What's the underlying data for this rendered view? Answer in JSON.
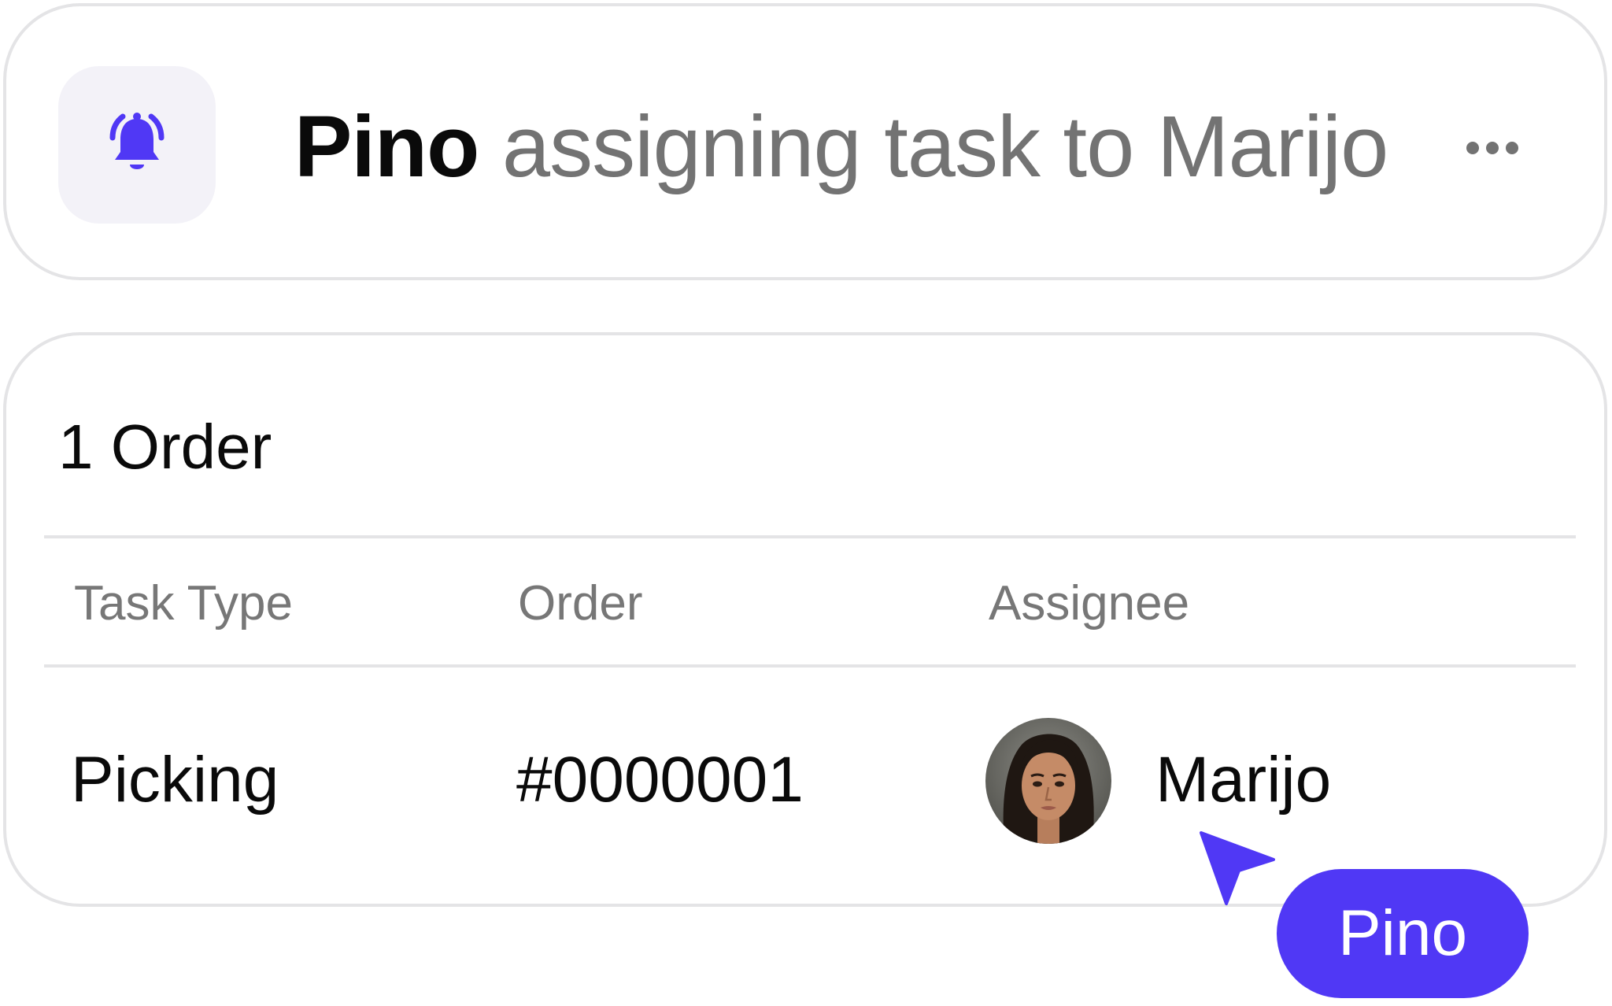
{
  "notification": {
    "actor": "Pino",
    "message": "assigning task to Marijo",
    "icon": "bell-ringing-icon",
    "more_icon": "ellipsis-icon"
  },
  "order_card": {
    "title": "1 Order",
    "columns": [
      "Task Type",
      "Order",
      "Assignee"
    ],
    "rows": [
      {
        "task_type": "Picking",
        "order": "#0000001",
        "assignee": "Marijo"
      }
    ]
  },
  "cursor": {
    "label": "Pino",
    "icon": "cursor-arrow-icon"
  },
  "colors": {
    "accent": "#5038f5",
    "muted_text": "#737373",
    "border": "#e4e4e6",
    "tile_bg": "#f3f2f8"
  }
}
